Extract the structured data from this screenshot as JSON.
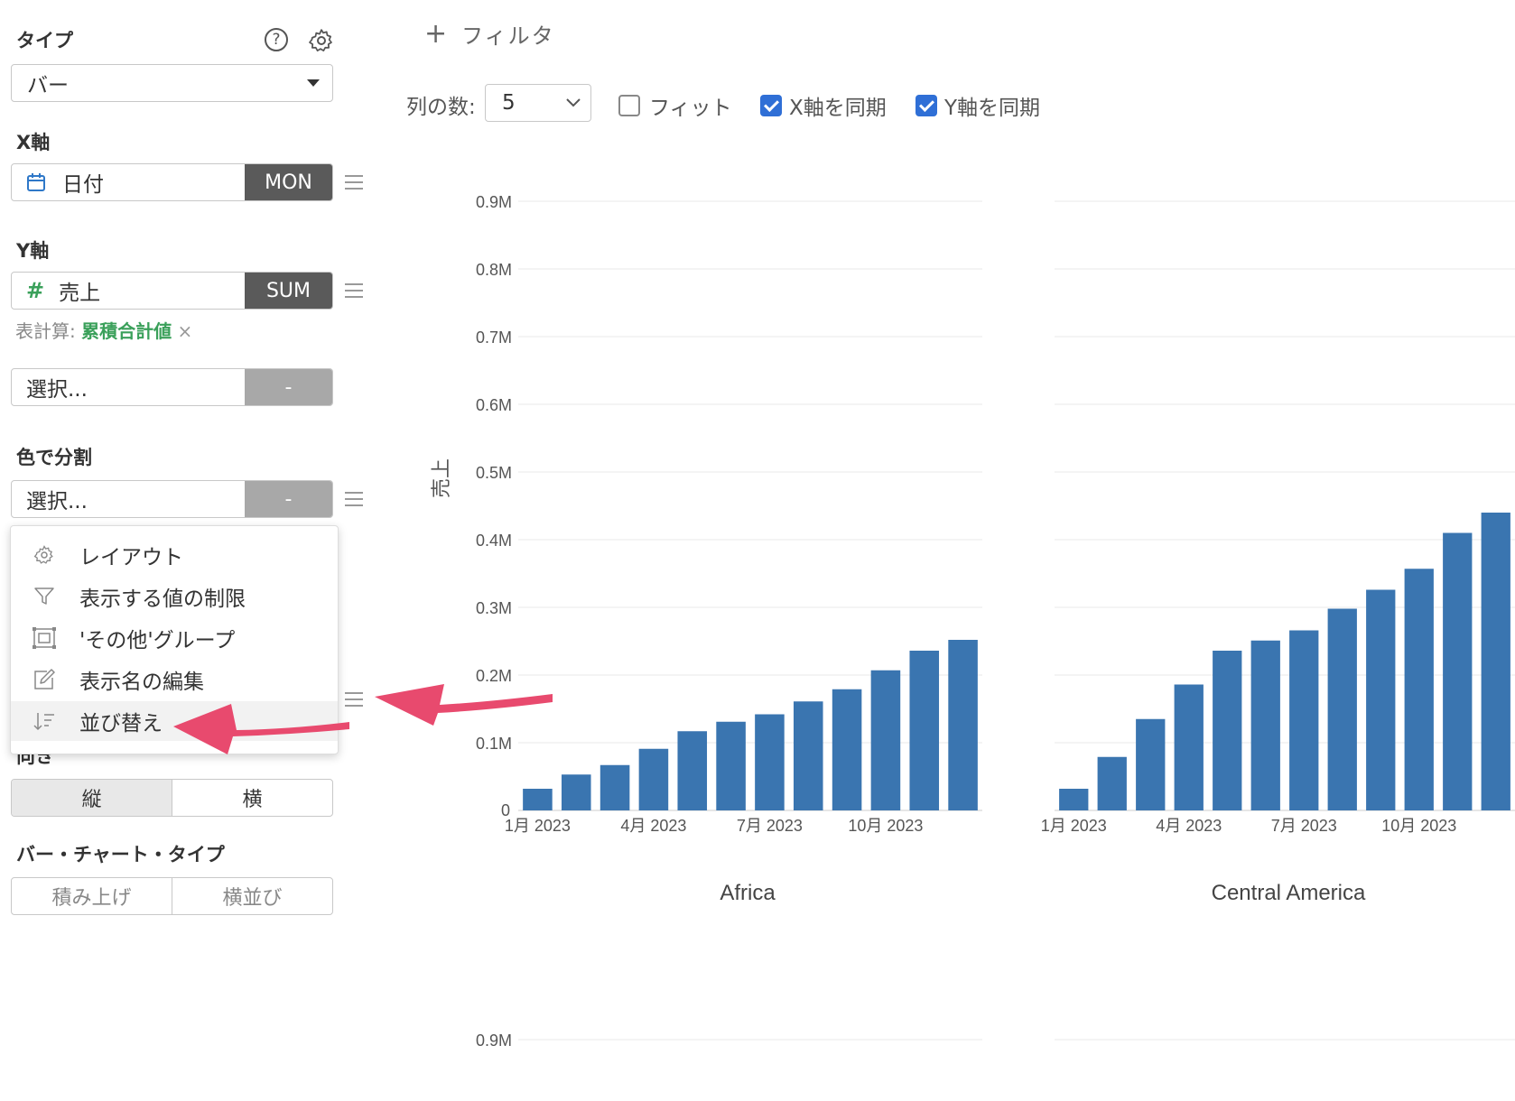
{
  "sidebar": {
    "type_section": {
      "label": "タイプ",
      "value": "バー"
    },
    "x_axis": {
      "label": "X軸",
      "field": "日付",
      "agg": "MON"
    },
    "y_axis": {
      "label": "Y軸",
      "field": "売上",
      "agg": "SUM",
      "calc_label": "表計算:",
      "calc_value": "累積合計値",
      "remove": "×"
    },
    "extra_field": {
      "placeholder": "選択...",
      "agg": "-"
    },
    "color_split": {
      "label": "色で分割",
      "placeholder": "選択...",
      "agg": "-"
    },
    "context_menu": [
      {
        "label": "レイアウト",
        "icon": "gear-icon"
      },
      {
        "label": "表示する値の制限",
        "icon": "filter-icon"
      },
      {
        "label": "'その他'グループ",
        "icon": "group-icon"
      },
      {
        "label": "表示名の編集",
        "icon": "edit-icon"
      },
      {
        "label": "並び替え",
        "icon": "sort-icon"
      }
    ],
    "orientation": {
      "label": "向き",
      "options": [
        "縦",
        "横"
      ],
      "selected": "縦"
    },
    "bar_chart_type": {
      "label": "バー・チャート・タイプ",
      "options": [
        "積み上げ",
        "横並び"
      ]
    }
  },
  "toolbar": {
    "filter_label": "フィルタ",
    "columns_label": "列の数:",
    "columns_value": "5",
    "fit_label": "フィット",
    "fit_checked": false,
    "sync_x_label": "X軸を同期",
    "sync_x_checked": true,
    "sync_y_label": "Y軸を同期",
    "sync_y_checked": true
  },
  "colors": {
    "bar": "#3a75b0",
    "arrow": "#e84a6e",
    "accent_green": "#3aa05a",
    "checkbox": "#2f6fd6"
  },
  "chart_data": [
    {
      "type": "bar",
      "title": "Africa",
      "ylabel": "売上",
      "ylim": [
        0,
        900000
      ],
      "yticks": [
        "0",
        "0.1M",
        "0.2M",
        "0.3M",
        "0.4M",
        "0.5M",
        "0.6M",
        "0.7M",
        "0.8M",
        "0.9M"
      ],
      "x_tick_labels": [
        "1月 2023",
        "4月 2023",
        "7月 2023",
        "10月 2023"
      ],
      "categories": [
        "2023-01",
        "2023-02",
        "2023-03",
        "2023-04",
        "2023-05",
        "2023-06",
        "2023-07",
        "2023-08",
        "2023-09",
        "2023-10",
        "2023-11",
        "2023-12"
      ],
      "values": [
        32000,
        53000,
        67000,
        91000,
        117000,
        131000,
        142000,
        161000,
        179000,
        207000,
        236000,
        252000
      ]
    },
    {
      "type": "bar",
      "title": "Central America",
      "ylim": [
        0,
        900000
      ],
      "x_tick_labels": [
        "1月 2023",
        "4月 2023",
        "7月 2023",
        "10月 2023"
      ],
      "categories": [
        "2023-01",
        "2023-02",
        "2023-03",
        "2023-04",
        "2023-05",
        "2023-06",
        "2023-07",
        "2023-08",
        "2023-09",
        "2023-10",
        "2023-11",
        "2023-12"
      ],
      "values": [
        32000,
        79000,
        135000,
        186000,
        236000,
        251000,
        266000,
        298000,
        326000,
        357000,
        410000,
        440000
      ]
    },
    {
      "type": "bar",
      "ylim": [
        0,
        900000
      ],
      "yticks": [
        "0.9M"
      ]
    }
  ]
}
